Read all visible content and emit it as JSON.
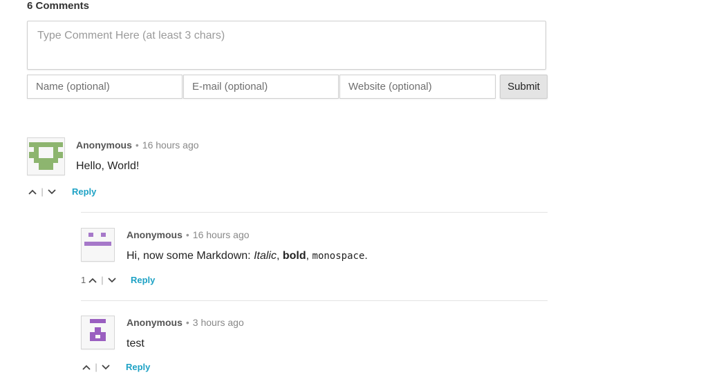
{
  "header": {
    "comment_count": "6 Comments"
  },
  "form": {
    "comment_placeholder": "Type Comment Here (at least 3 chars)",
    "name_placeholder": "Name (optional)",
    "email_placeholder": "E-mail (optional)",
    "website_placeholder": "Website (optional)",
    "submit_label": "Submit"
  },
  "comments": [
    {
      "author": "Anonymous",
      "separator": "•",
      "time": "16 hours ago",
      "text": "Hello, World!",
      "score": "",
      "reply_label": "Reply",
      "avatar_color": "#8db56f"
    },
    {
      "author": "Anonymous",
      "separator": "•",
      "time": "16 hours ago",
      "text_prefix": "Hi, now some Markdown: ",
      "text_italic": "Italic",
      "text_comma1": ", ",
      "text_bold": "bold",
      "text_comma2": ", ",
      "text_mono": "monospace",
      "text_end": ".",
      "score": "1",
      "reply_label": "Reply",
      "avatar_color": "#a678c9"
    },
    {
      "author": "Anonymous",
      "separator": "•",
      "time": "3 hours ago",
      "text": "test",
      "score": "",
      "reply_label": "Reply",
      "avatar_color": "#9a5fc0"
    }
  ],
  "icons": {
    "upvote": "chevron-up-icon",
    "downvote": "chevron-down-icon",
    "upvote_glyph": "^",
    "downvote_glyph": "⌄",
    "vote_separator": "|"
  }
}
